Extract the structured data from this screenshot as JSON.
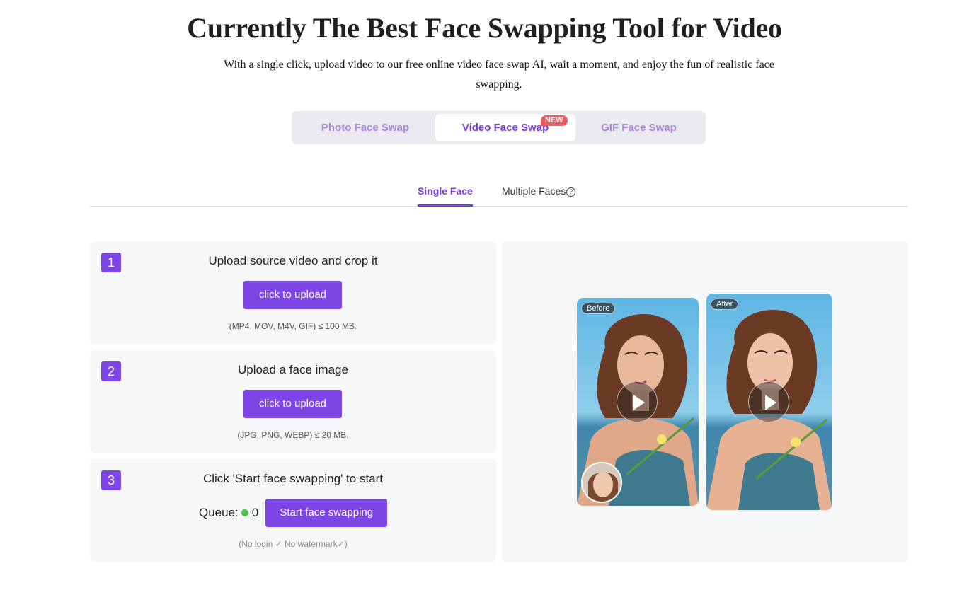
{
  "hero": {
    "title": "Currently The Best Face Swapping Tool for Video",
    "subtitle": "With a single click, upload video to our free online video face swap AI, wait a moment, and enjoy the fun of realistic face swapping."
  },
  "mode_tabs": {
    "photo": "Photo Face Swap",
    "video": "Video Face Swap",
    "gif": "GIF Face Swap",
    "new_badge": "NEW",
    "active": "video"
  },
  "face_tabs": {
    "single": "Single Face",
    "multiple": "Multiple Faces",
    "help_icon": "?",
    "active": "single"
  },
  "steps": [
    {
      "number": "1",
      "title": "Upload source video and crop it",
      "button": "click to upload",
      "note": "(MP4, MOV, M4V, GIF) ≤ 100 MB."
    },
    {
      "number": "2",
      "title": "Upload a face image",
      "button": "click to upload",
      "note": "(JPG, PNG, WEBP) ≤ 20 MB."
    },
    {
      "number": "3",
      "title": "Click 'Start face swapping' to start",
      "queue_label": "Queue:",
      "queue_count": "0",
      "button": "Start face swapping",
      "note": "(No login ✓ No watermark✓)"
    }
  ],
  "preview": {
    "before_label": "Before",
    "after_label": "After"
  },
  "colors": {
    "accent": "#7e45e6",
    "badge": "#f2575f",
    "queue_dot": "#4cc04a"
  }
}
